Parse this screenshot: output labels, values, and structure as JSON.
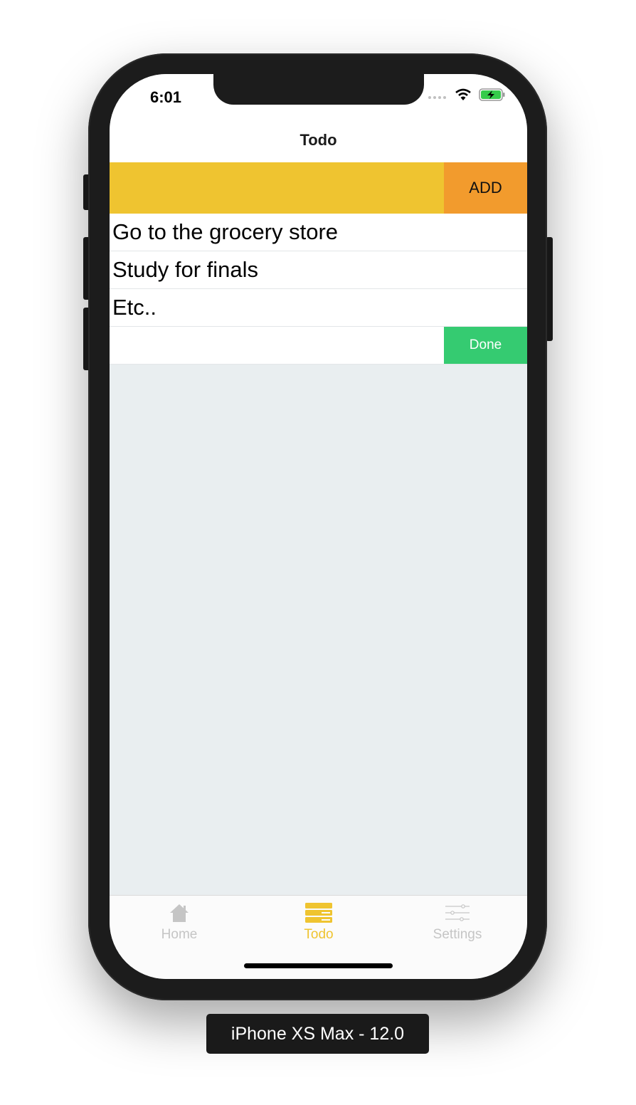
{
  "status_bar": {
    "time": "6:01"
  },
  "nav": {
    "title": "Todo"
  },
  "add_row": {
    "input_value": "",
    "button_label": "ADD"
  },
  "todos": [
    {
      "text": "Go to the grocery store"
    },
    {
      "text": "Study for finals"
    },
    {
      "text": "Etc.."
    },
    {
      "text": ""
    }
  ],
  "done_label": "Done",
  "tabs": [
    {
      "label": "Home",
      "icon": "home-icon",
      "active": false
    },
    {
      "label": "Todo",
      "icon": "list-icon",
      "active": true
    },
    {
      "label": "Settings",
      "icon": "sliders-icon",
      "active": false
    }
  ],
  "device_label": "iPhone XS Max - 12.0",
  "colors": {
    "input_bg": "#efc430",
    "add_button_bg": "#f29b2d",
    "done_button_bg": "#35cb71",
    "active_tab": "#efc430",
    "inactive_tab": "#c5c5c5",
    "content_bg": "#e9eef0"
  }
}
